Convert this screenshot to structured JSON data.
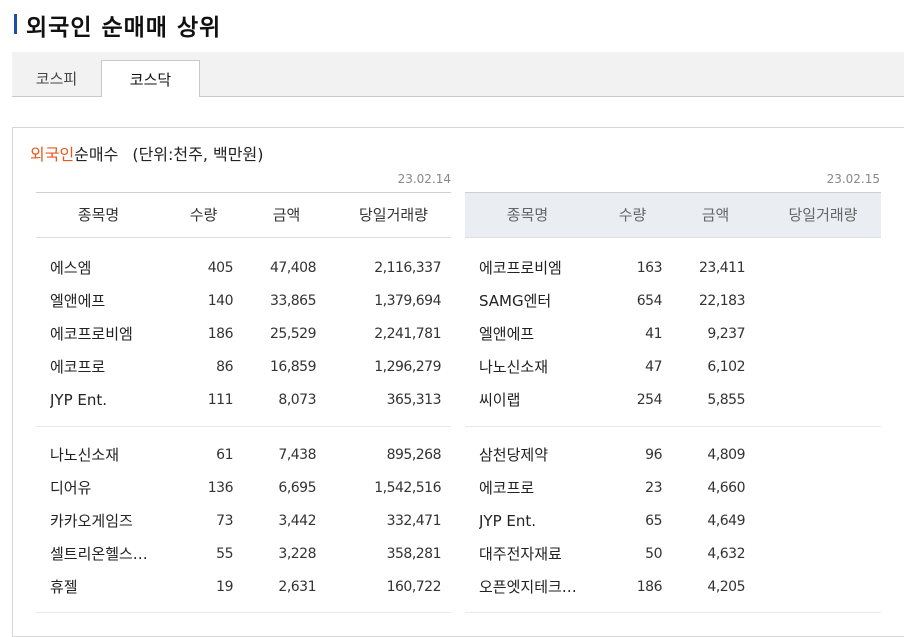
{
  "page": {
    "title": "외국인 순매매 상위"
  },
  "tabs": [
    {
      "label": "코스피",
      "active": false
    },
    {
      "label": "코스닥",
      "active": true
    }
  ],
  "subtitle": {
    "highlight": "외국인",
    "text": "순매수",
    "unit": "(단위:천주, 백만원)"
  },
  "colors": {
    "accent": "#e8581c",
    "title_bar": "#1e4fa8",
    "right_header_bg": "#eaedf2"
  },
  "left": {
    "date": "23.02.14",
    "headers": [
      "종목명",
      "수량",
      "금액",
      "당일거래량"
    ],
    "rows": [
      [
        "에스엠",
        "405",
        "47,408",
        "2,116,337"
      ],
      [
        "엘앤에프",
        "140",
        "33,865",
        "1,379,694"
      ],
      [
        "에코프로비엠",
        "186",
        "25,529",
        "2,241,781"
      ],
      [
        "에코프로",
        "86",
        "16,859",
        "1,296,279"
      ],
      [
        "JYP Ent.",
        "111",
        "8,073",
        "365,313"
      ],
      [
        "나노신소재",
        "61",
        "7,438",
        "895,268"
      ],
      [
        "디어유",
        "136",
        "6,695",
        "1,542,516"
      ],
      [
        "카카오게임즈",
        "73",
        "3,442",
        "332,471"
      ],
      [
        "셀트리온헬스…",
        "55",
        "3,228",
        "358,281"
      ],
      [
        "휴젤",
        "19",
        "2,631",
        "160,722"
      ]
    ]
  },
  "right": {
    "date": "23.02.15",
    "headers": [
      "종목명",
      "수량",
      "금액",
      "당일거래량"
    ],
    "rows": [
      [
        "에코프로비엠",
        "163",
        "23,411",
        ""
      ],
      [
        "SAMG엔터",
        "654",
        "22,183",
        ""
      ],
      [
        "엘앤에프",
        "41",
        "9,237",
        ""
      ],
      [
        "나노신소재",
        "47",
        "6,102",
        ""
      ],
      [
        "씨이랩",
        "254",
        "5,855",
        ""
      ],
      [
        "삼천당제약",
        "96",
        "4,809",
        ""
      ],
      [
        "에코프로",
        "23",
        "4,660",
        ""
      ],
      [
        "JYP Ent.",
        "65",
        "4,649",
        ""
      ],
      [
        "대주전자재료",
        "50",
        "4,632",
        ""
      ],
      [
        "오픈엣지테크…",
        "186",
        "4,205",
        ""
      ]
    ]
  }
}
